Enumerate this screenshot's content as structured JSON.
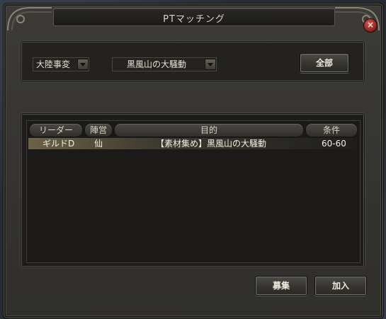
{
  "window": {
    "title": "PTマッチング"
  },
  "filters": {
    "region": "大陸事変",
    "area": "黒風山の大騒動",
    "all_button": "全部"
  },
  "table": {
    "columns": [
      "リーダー",
      "陣営",
      "目的",
      "条件"
    ],
    "rows": [
      {
        "leader": "ギルドD",
        "faction": "仙",
        "purpose": "【素材集め】黒風山の大騒動",
        "condition": "60-60"
      }
    ]
  },
  "actions": {
    "recruit_label": "募集",
    "join_label": "加入"
  },
  "colors": {
    "accent_close": "#b0302a",
    "row_highlight": "#6d6247"
  }
}
